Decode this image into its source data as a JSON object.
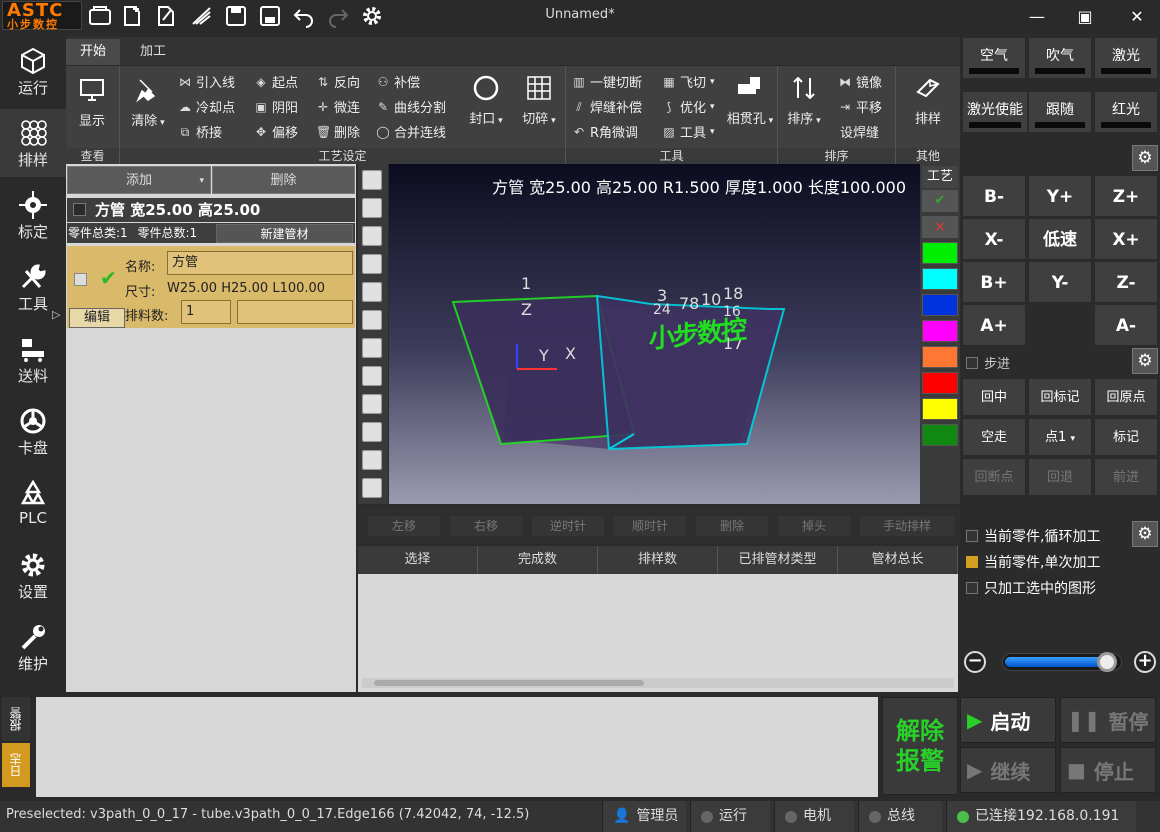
{
  "app": {
    "logo_top": "ASTC",
    "logo_bottom": "小步数控",
    "title": "Unnamed*"
  },
  "leftnav": [
    {
      "label": "运行",
      "icon": "cube-icon"
    },
    {
      "label": "排样",
      "icon": "circles-grid-icon"
    },
    {
      "label": "标定",
      "icon": "crosshair-icon"
    },
    {
      "label": "工具",
      "icon": "wrench-icon"
    },
    {
      "label": "送料",
      "icon": "feeder-icon"
    },
    {
      "label": "卡盘",
      "icon": "chuck-icon"
    },
    {
      "label": "PLC",
      "icon": "recycle-icon"
    },
    {
      "label": "设置",
      "icon": "gear-icon"
    },
    {
      "label": "维护",
      "icon": "maintenance-wrench-icon"
    }
  ],
  "ribbon": {
    "tabs": [
      "开始",
      "加工"
    ],
    "groups": {
      "view": "查看",
      "process": "工艺设定",
      "tools": "工具",
      "sort": "排序",
      "other": "其他"
    },
    "display": "显示",
    "clear": "清除",
    "lead_line": "引入线",
    "cooling": "冷却点",
    "bridge": "桥接",
    "start_point": "起点",
    "positive": "阴阳",
    "offset": "偏移",
    "reverse": "反向",
    "micro_joint": "微连",
    "delete": "删除",
    "compensate": "补偿",
    "curve_split": "曲线分割",
    "merge_lines": "合并连线",
    "seal": "封口",
    "shred": "切碎",
    "one_key_cut": "一键切断",
    "weld_comp": "焊缝补偿",
    "r_corner": "R角微调",
    "fly_cut": "飞切",
    "optimize": "优化",
    "tools": "工具",
    "through_hole": "相贯孔",
    "sort": "排序",
    "mirror": "镜像",
    "translate": "平移",
    "set_seam": "设焊缝",
    "nest": "排样"
  },
  "leftpanel": {
    "add": "添加",
    "delete": "删除",
    "tube_header": "方管 宽25.00 高25.00",
    "part_types": "零件总类:1",
    "part_total": "零件总数:1",
    "new_tube": "新建管材",
    "name_label": "名称:",
    "name_value": "方管",
    "size_label": "尺寸:",
    "size_value": "W25.00 H25.00 L100.00",
    "edit": "编辑",
    "nest_count_label": "排料数:",
    "nest_count_value": "1"
  },
  "viewport": {
    "header": "方管 宽25.00 高25.00 R1.500 厚度1.000 长度100.000",
    "label_1": "1",
    "axis_z": "Z",
    "axis_y": "Y",
    "axis_x": "X",
    "label_3": "3",
    "label_18": "18",
    "label_24": "24",
    "label_78": "78",
    "label_10": "10",
    "label_17": "17",
    "label_16": "16",
    "watermark": "小步数控"
  },
  "process_bar": {
    "title": "工艺",
    "check": "✔",
    "cross": "×",
    "colors": [
      "#00ee00",
      "#00ffff",
      "#0033dd",
      "#ff00ff",
      "#ff7733",
      "#ff0000",
      "#ffff00",
      "#118811"
    ]
  },
  "editbar": [
    "左移",
    "右移",
    "逆时针",
    "顺时针",
    "删除",
    "掉头",
    "手动排样"
  ],
  "table": {
    "columns": [
      "选择",
      "完成数",
      "排样数",
      "已排管材类型",
      "管材总长"
    ]
  },
  "rightpanel": {
    "air": "空气",
    "blow": "吹气",
    "laser": "激光",
    "laser_enable": "激光使能",
    "follow": "跟随",
    "red_light": "红光",
    "jog": {
      "b_minus": "B-",
      "y_plus": "Y+",
      "z_plus": "Z+",
      "x_minus": "X-",
      "low_speed": "低速",
      "x_plus": "X+",
      "b_plus": "B+",
      "y_minus": "Y-",
      "z_minus": "Z-",
      "a_plus": "A+",
      "a_minus": "A-"
    },
    "step": "步进",
    "back_center": "回中",
    "back_mark": "回标记",
    "back_origin": "回原点",
    "dry_run": "空走",
    "point_select": "点1",
    "mark": "标记",
    "back_breakpoint": "回断点",
    "back_step": "回退",
    "forward": "前进",
    "loop_current": "当前零件,循环加工",
    "single_current": "当前零件,单次加工",
    "selected_only": "只加工选中的图形",
    "speed_level": 0.9
  },
  "bottom": {
    "alarm_tab": "报警",
    "log_tab": "日志",
    "clear_alarm": "解除报警",
    "start": "启动",
    "pause": "暂停",
    "continue": "继续",
    "stop": "停止"
  },
  "status": {
    "preselected": "Preselected: v3path_0_0_17 - tube.v3path_0_0_17.Edge166 (7.42042, 74, -12.5)",
    "admin": "管理员",
    "running": "运行",
    "motor": "电机",
    "bus": "总线",
    "connected": "已连接192.168.0.191"
  }
}
